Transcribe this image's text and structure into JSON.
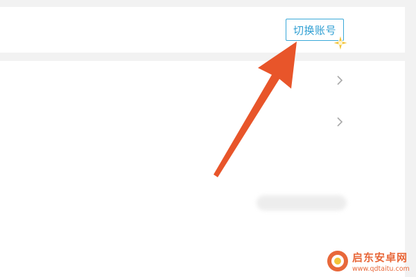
{
  "header": {
    "switch_account_label": "切换账号"
  },
  "list": {
    "rows": [
      {
        "chevron_icon": "chevron-right-icon"
      },
      {
        "chevron_icon": "chevron-right-icon"
      }
    ]
  },
  "annotation": {
    "arrow_color": "#e8552a",
    "icon": "arrow-pointer-icon"
  },
  "watermark": {
    "name": "启东安卓网",
    "url": "www.qdtaitu.com",
    "color": "#e8683a"
  },
  "colors": {
    "accent": "#2f9fd3",
    "background": "#f2f2f2",
    "card": "#ffffff"
  }
}
